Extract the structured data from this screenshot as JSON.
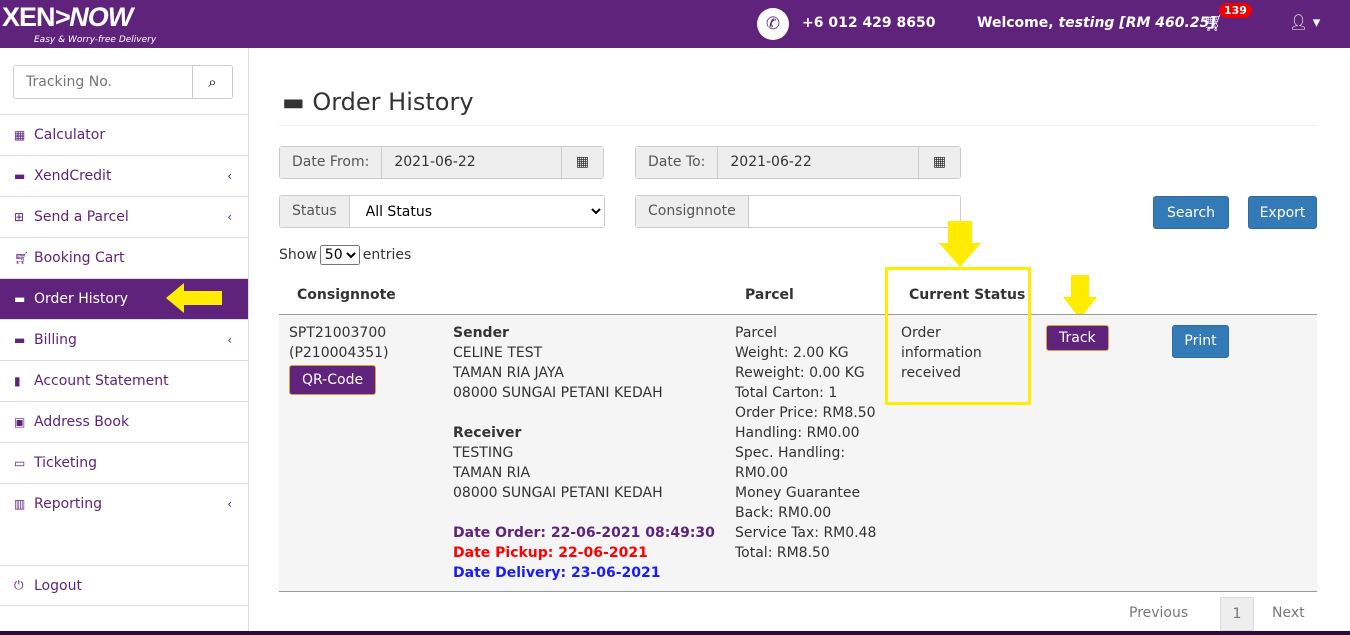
{
  "header": {
    "logo": "XEN>NOW",
    "tagline": "Easy & Worry-free Delivery",
    "phone": "+6 012 429 8650",
    "welcome": "Welcome,",
    "user": "testing [RM 460.25]",
    "cart_count": "139"
  },
  "sidebar": {
    "tracking_placeholder": "Tracking No.",
    "items": [
      {
        "label": "Calculator",
        "icon": "calculator-icon"
      },
      {
        "label": "XendCredit",
        "icon": "credit-card-icon",
        "chev": "‹"
      },
      {
        "label": "Send a Parcel",
        "icon": "plus-square-icon",
        "chev": "‹"
      },
      {
        "label": "Booking Cart",
        "icon": "cart-icon"
      },
      {
        "label": "Order History",
        "icon": "archive-icon",
        "active": true
      },
      {
        "label": "Billing",
        "icon": "credit-card-icon",
        "chev": "‹"
      },
      {
        "label": "Account Statement",
        "icon": "clipboard-icon"
      },
      {
        "label": "Address Book",
        "icon": "address-book-icon"
      },
      {
        "label": "Ticketing",
        "icon": "ticket-icon"
      },
      {
        "label": "Reporting",
        "icon": "chart-icon",
        "chev": "‹"
      }
    ],
    "logout": "Logout"
  },
  "main": {
    "title": "Order History",
    "filters": {
      "date_from_label": "Date From:",
      "date_from": "2021-06-22",
      "date_to_label": "Date To:",
      "date_to": "2021-06-22",
      "status_label": "Status",
      "status_value": "All Status",
      "consignnote_label": "Consignnote",
      "consignnote_value": "",
      "search": "Search",
      "export": "Export"
    },
    "show": "Show",
    "entries_value": "50",
    "entries": "entries",
    "columns": [
      "Consignnote",
      "Parcel",
      "Current Status"
    ],
    "row": {
      "consignnote": "SPT21003700",
      "ref": "(P210004351)",
      "qr": "QR-Code",
      "sender_h": "Sender",
      "sender": [
        "CELINE TEST",
        "TAMAN RIA JAYA",
        "08000 SUNGAI PETANI KEDAH"
      ],
      "receiver_h": "Receiver",
      "receiver": [
        "TESTING",
        "TAMAN RIA",
        "08000 SUNGAI PETANI KEDAH"
      ],
      "date_order": "Date Order: 22-06-2021 08:49:30",
      "date_pickup": "Date Pickup: 22-06-2021",
      "date_delivery": "Date Delivery: 23-06-2021",
      "parcel": [
        "Parcel",
        "Weight: 2.00 KG",
        "Reweight: 0.00 KG",
        "Total Carton: 1",
        "Order Price: RM8.50",
        "Handling: RM0.00",
        "Spec. Handling:",
        "RM0.00",
        "Money Guarantee",
        "Back: RM0.00",
        "Service Tax: RM0.48",
        "Total: RM8.50"
      ],
      "status": [
        "Order",
        "information",
        "received"
      ],
      "track": "Track",
      "print": "Print"
    },
    "pagination": {
      "previous": "Previous",
      "page": "1",
      "next": "Next"
    }
  },
  "colors": {
    "brand": "#5f237c",
    "highlight": "#ffec00",
    "primary": "#337ab7"
  }
}
